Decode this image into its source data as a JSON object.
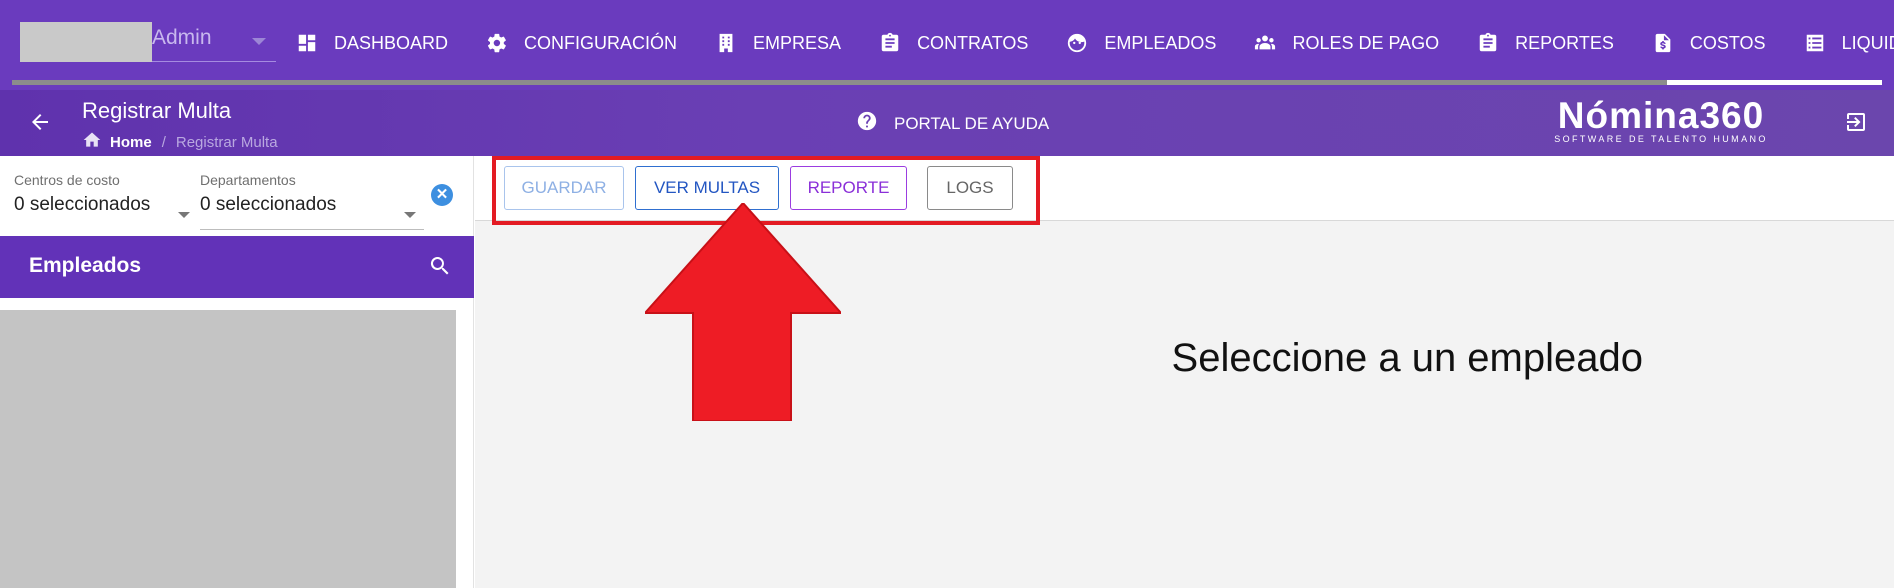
{
  "topnav": {
    "user_label": "Admin",
    "items": [
      {
        "label": "DASHBOARD",
        "icon": "dashboard-icon"
      },
      {
        "label": "CONFIGURACIÓN",
        "icon": "gear-icon"
      },
      {
        "label": "EMPRESA",
        "icon": "building-icon"
      },
      {
        "label": "CONTRATOS",
        "icon": "clipboard-icon"
      },
      {
        "label": "EMPLEADOS",
        "icon": "face-icon"
      },
      {
        "label": "ROLES DE PAGO",
        "icon": "group-icon"
      },
      {
        "label": "REPORTES",
        "icon": "clipboard-list-icon"
      },
      {
        "label": "COSTOS",
        "icon": "invoice-dollar-icon"
      },
      {
        "label": "LIQUIDACIONES",
        "icon": "list-icon"
      }
    ],
    "progress_fraction": 0.115
  },
  "header": {
    "title": "Registrar Multa",
    "breadcrumb": {
      "home": "Home",
      "separator": "/",
      "current": "Registrar Multa"
    },
    "help_label": "PORTAL DE AYUDA",
    "brand_name": "Nómina360",
    "brand_tagline": "SOFTWARE DE TALENTO HUMANO"
  },
  "filters": {
    "cost_centers": {
      "label": "Centros de costo",
      "value": "0 seleccionados"
    },
    "departments": {
      "label": "Departamentos",
      "value": "0 seleccionados"
    },
    "clear_symbol": "✕"
  },
  "employees": {
    "title": "Empleados"
  },
  "toolbar": {
    "guardar": "GUARDAR",
    "ver_multas": "VER MULTAS",
    "reporte": "REPORTE",
    "logs": "LOGS"
  },
  "main": {
    "empty_message": "Seleccione a un empleado"
  },
  "colors": {
    "nav_bg": "#6a3bbe",
    "annotation_red": "#e31b23",
    "primary_blue": "#2356c2",
    "purple": "#8a2fd8"
  }
}
